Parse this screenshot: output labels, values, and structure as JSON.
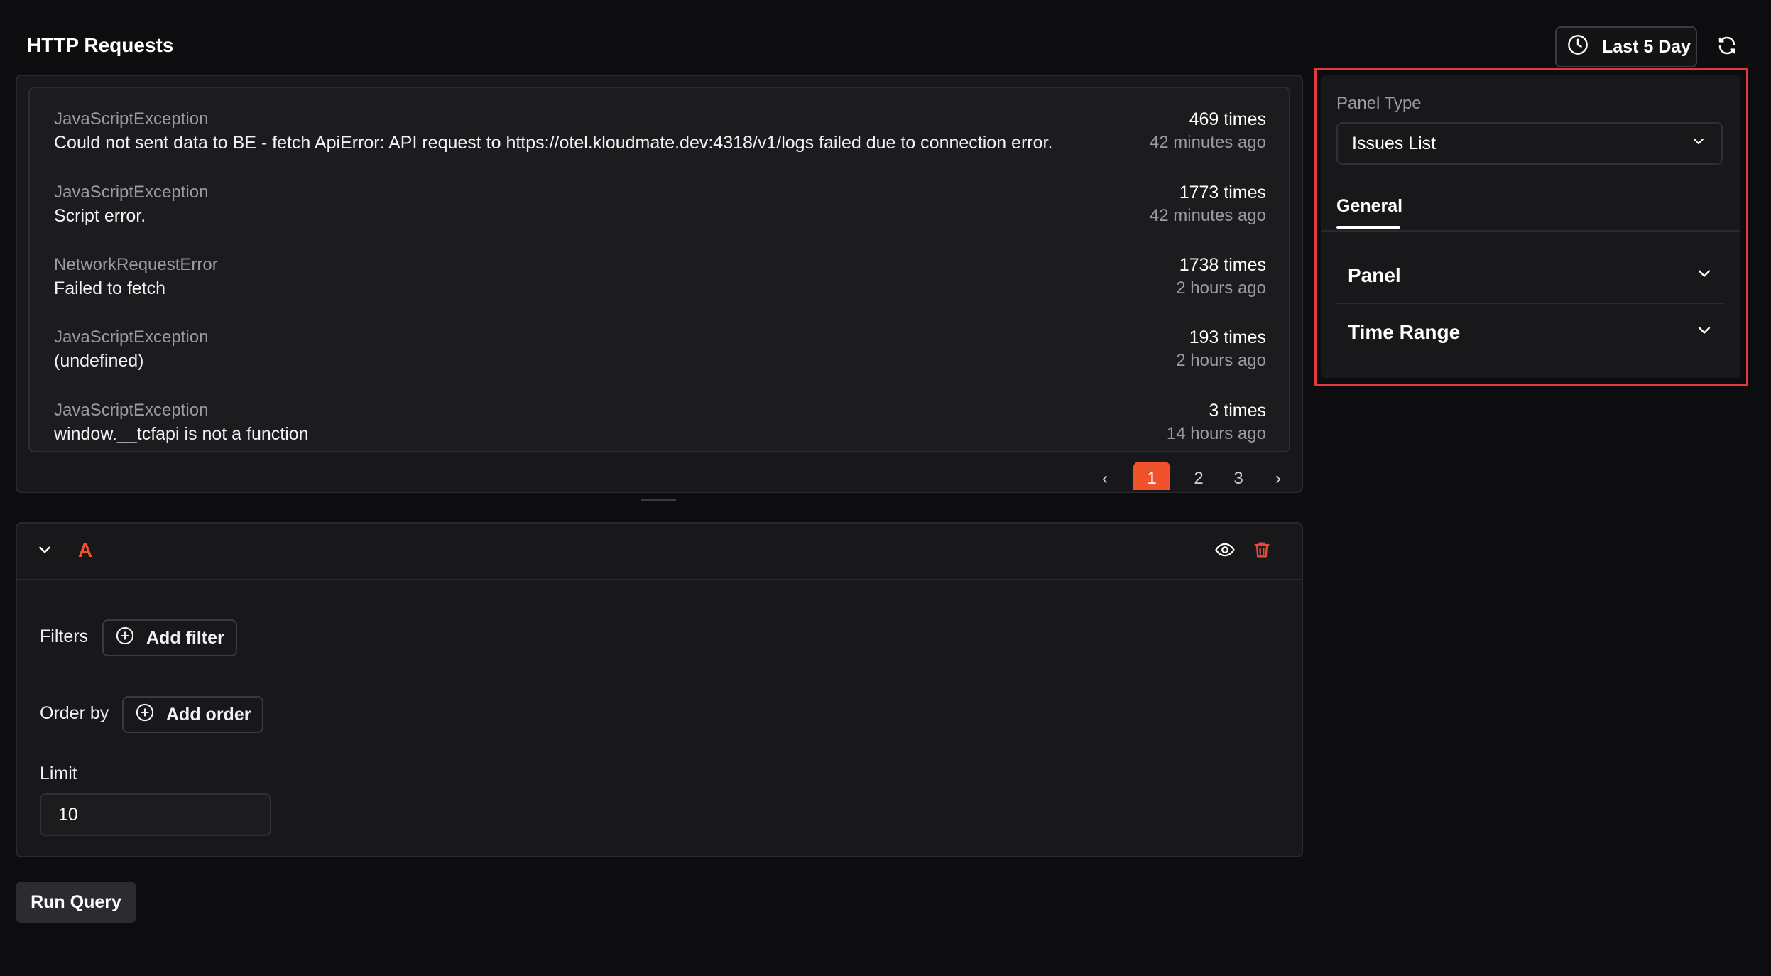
{
  "header": {
    "title": "HTTP Requests",
    "time_range_label": "Last 5 Day",
    "time_icon": "clock-icon",
    "refresh_icon": "refresh-icon"
  },
  "issues": [
    {
      "type": "JavaScriptException",
      "message": "Could not sent data to BE - fetch ApiError: API request to https://otel.kloudmate.dev:4318/v1/logs failed due to connection error.",
      "count": "469 times",
      "time": "42 minutes ago"
    },
    {
      "type": "JavaScriptException",
      "message": "Script error.",
      "count": "1773 times",
      "time": "42 minutes ago"
    },
    {
      "type": "NetworkRequestError",
      "message": "Failed to fetch",
      "count": "1738 times",
      "time": "2 hours ago"
    },
    {
      "type": "JavaScriptException",
      "message": "(undefined)",
      "count": "193 times",
      "time": "2 hours ago"
    },
    {
      "type": "JavaScriptException",
      "message": "window.__tcfapi is not a function",
      "count": "3 times",
      "time": "14 hours ago"
    }
  ],
  "pagination": {
    "prev": "‹",
    "pages": [
      "1",
      "2",
      "3"
    ],
    "current": "1",
    "next": "›"
  },
  "query": {
    "letter": "A",
    "filters_label": "Filters",
    "add_filter_label": "Add filter",
    "order_by_label": "Order by",
    "add_order_label": "Add order",
    "limit_label": "Limit",
    "limit_value": "10",
    "run_label": "Run Query"
  },
  "settings": {
    "panel_type_label": "Panel Type",
    "panel_type_value": "Issues List",
    "tabs": [
      "General"
    ],
    "sections": [
      "Panel",
      "Time Range"
    ]
  },
  "colors": {
    "accent": "#f0522b",
    "highlight_border": "#e03a3a",
    "background": "#0d0d0f"
  }
}
